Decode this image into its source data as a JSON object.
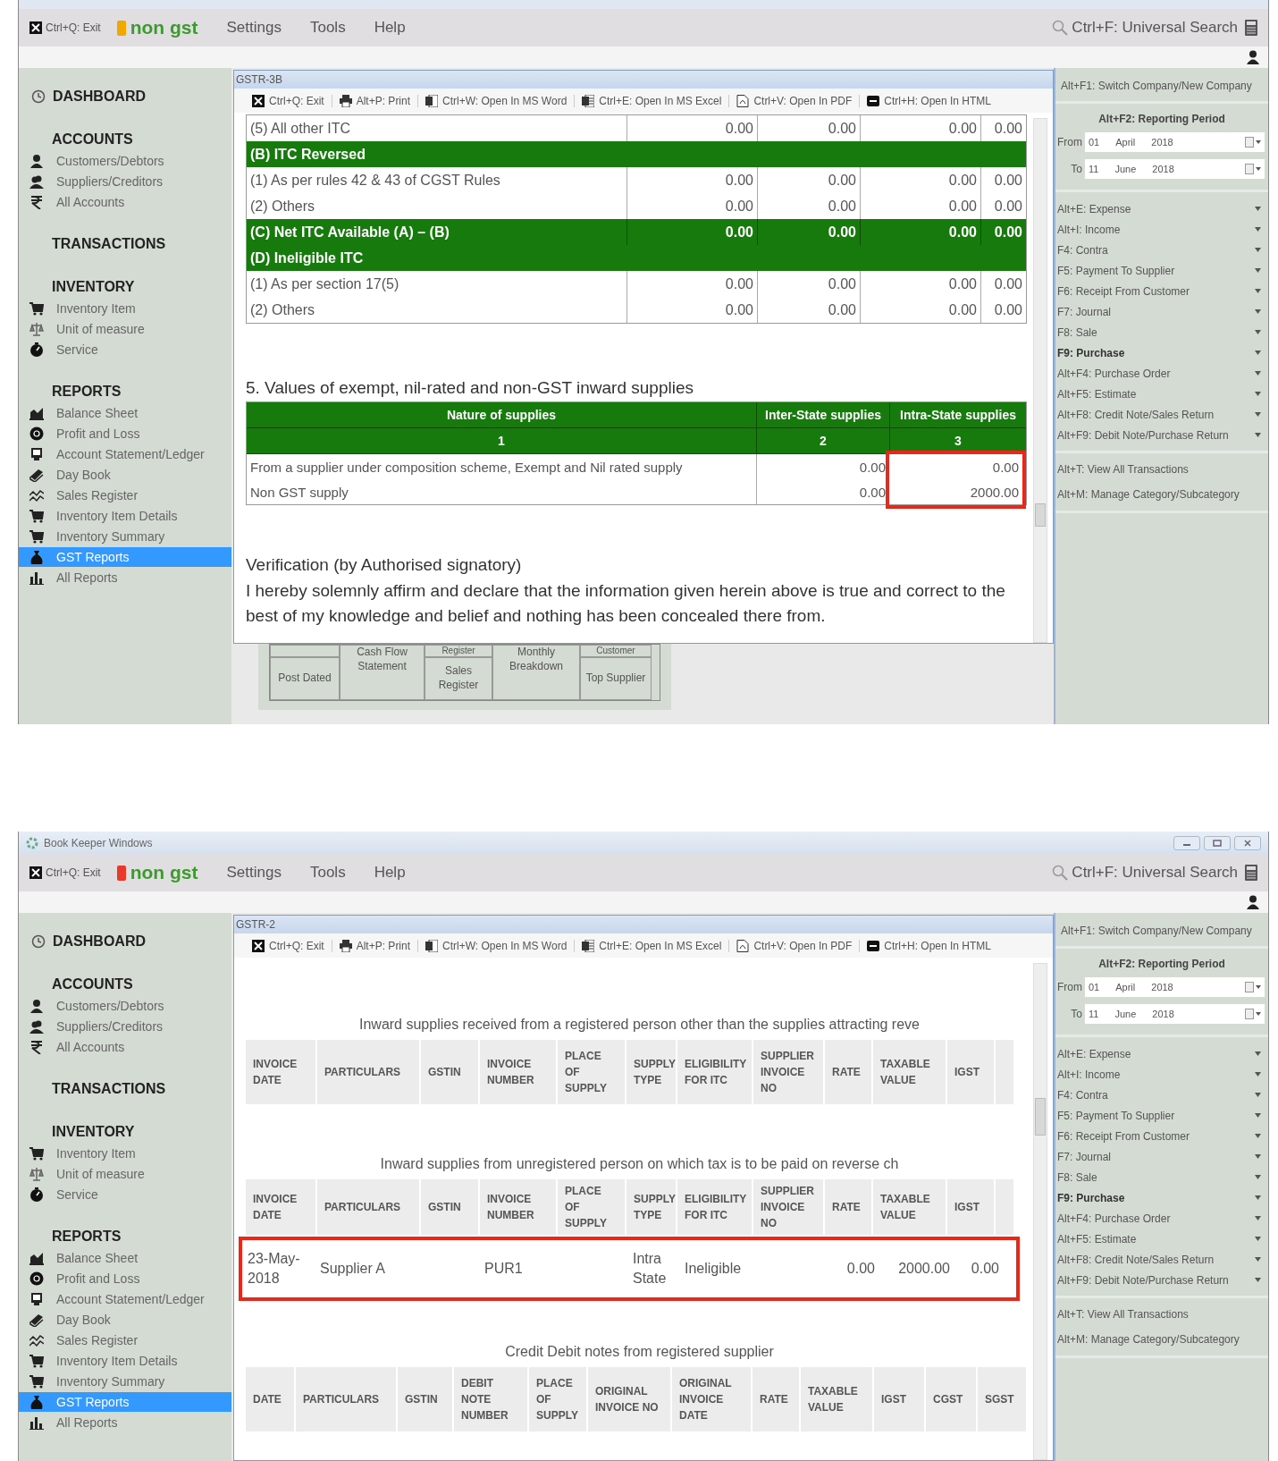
{
  "windows": [
    {
      "menubar": {
        "exit": "Ctrl+Q: Exit",
        "company": {
          "name": "non gst",
          "color": "#f0a800"
        },
        "menus": [
          "Settings",
          "Tools",
          "Help"
        ],
        "search": "Ctrl+F: Universal Search"
      },
      "sidebar": {
        "dashboard": "DASHBOARD",
        "sections": [
          {
            "title": "ACCOUNTS",
            "items": [
              {
                "label": "Customers/Debtors",
                "selected": false
              },
              {
                "label": "Suppliers/Creditors",
                "selected": false
              },
              {
                "label": "All Accounts",
                "selected": false
              }
            ]
          },
          {
            "title": "TRANSACTIONS"
          },
          {
            "title": "INVENTORY",
            "items": [
              {
                "label": "Inventory Item",
                "selected": false
              },
              {
                "label": "Unit of measure",
                "selected": false
              },
              {
                "label": "Service",
                "selected": false
              }
            ]
          },
          {
            "title": "REPORTS",
            "items": [
              {
                "label": "Balance Sheet",
                "selected": false
              },
              {
                "label": "Profit and Loss",
                "selected": false
              },
              {
                "label": "Account Statement/Ledger",
                "selected": false
              },
              {
                "label": "Day Book",
                "selected": false
              },
              {
                "label": "Sales Register",
                "selected": false
              },
              {
                "label": "Inventory Item Details",
                "selected": false
              },
              {
                "label": "Inventory Summary",
                "selected": false
              },
              {
                "label": "GST Reports",
                "selected": true
              },
              {
                "label": "All Reports",
                "selected": false
              }
            ]
          }
        ]
      },
      "dialog": {
        "kind": "gstr3b",
        "title": "GSTR-3B",
        "toolbar": [
          "Ctrl+Q: Exit",
          "Alt+P: Print",
          "Ctrl+W: Open In MS Word",
          "Ctrl+E: Open In MS Excel",
          "Ctrl+V: Open In PDF",
          "Ctrl+H: Open In HTML"
        ],
        "itc_rows": [
          {
            "kind": "row",
            "cells": [
              "(5) All other ITC",
              "0.00",
              "0.00",
              "0.00",
              "0.00"
            ]
          },
          {
            "kind": "group",
            "cells": [
              "(B) ITC Reversed"
            ]
          },
          {
            "kind": "row",
            "cells": [
              "(1) As per rules 42 & 43 of CGST Rules",
              "0.00",
              "0.00",
              "0.00",
              "0.00"
            ]
          },
          {
            "kind": "row",
            "cells": [
              "(2) Others",
              "0.00",
              "0.00",
              "0.00",
              "0.00"
            ]
          },
          {
            "kind": "total",
            "cells": [
              "(C) Net ITC Available (A) – (B)",
              "0.00",
              "0.00",
              "0.00",
              "0.00"
            ]
          },
          {
            "kind": "group",
            "cells": [
              "(D) Ineligible ITC"
            ]
          },
          {
            "kind": "row",
            "cells": [
              "(1) As per section 17(5)",
              "0.00",
              "0.00",
              "0.00",
              "0.00"
            ]
          },
          {
            "kind": "row",
            "cells": [
              "(2) Others",
              "0.00",
              "0.00",
              "0.00",
              "0.00"
            ]
          }
        ],
        "supply_heading": "5. Values of exempt, nil-rated and non-GST inward supplies",
        "supply_columns": [
          {
            "label": "Nature of supplies",
            "number": "1",
            "highlighted": false
          },
          {
            "label": "Inter-State supplies",
            "number": "2",
            "highlighted": false
          },
          {
            "label": "Intra-State supplies",
            "number": "3",
            "highlighted": true
          }
        ],
        "supply_rows": [
          [
            "From a supplier under composition scheme, Exempt and Nil rated supply",
            "0.00",
            "0.00"
          ],
          [
            "Non GST supply",
            "0.00",
            "2000.00"
          ]
        ],
        "verification_title": "Verification (by Authorised signatory)",
        "verification_text": "I hereby solemnly affirm and declare that the information given herein above is true and correct to the best of my knowledge and belief and nothing has been concealed there from."
      },
      "tiles": [
        {
          "label": "Post Dated"
        },
        {
          "label": "Cash Flow Statement"
        },
        {
          "top": "Register",
          "label": "Sales Register"
        },
        {
          "label": "Monthly Breakdown"
        },
        {
          "top": "Customer",
          "label": "Top Supplier"
        }
      ],
      "right_panel": {
        "switch_company": "Alt+F1: Switch Company/New Company",
        "period_title": "Alt+F2: Reporting Period",
        "dates": [
          {
            "label": "From",
            "day": "01",
            "month": "April",
            "year": "2018"
          },
          {
            "label": "To",
            "day": "11",
            "month": "June",
            "year": "2018"
          }
        ],
        "menu": [
          {
            "label": "Alt+E: Expense",
            "selected": false
          },
          {
            "label": "Alt+I: Income",
            "selected": false
          },
          {
            "label": "F4: Contra",
            "selected": false
          },
          {
            "label": "F5: Payment To Supplier",
            "selected": false
          },
          {
            "label": "F6: Receipt From Customer",
            "selected": false
          },
          {
            "label": "F7: Journal",
            "selected": false
          },
          {
            "label": "F8: Sale",
            "selected": false
          },
          {
            "label": "F9: Purchase",
            "selected": true
          },
          {
            "label": "Alt+F4: Purchase Order",
            "selected": false
          },
          {
            "label": "Alt+F5: Estimate",
            "selected": false
          },
          {
            "label": "Alt+F8: Credit Note/Sales Return",
            "selected": false
          },
          {
            "label": "Alt+F9: Debit Note/Purchase Return",
            "selected": false
          }
        ],
        "links": [
          "Alt+T: View All Transactions",
          "Alt+M: Manage Category/Subcategory"
        ]
      }
    },
    {
      "title": "Book Keeper Windows",
      "menubar": {
        "exit": "Ctrl+Q: Exit",
        "company": {
          "name": "non gst",
          "color": "#e83a2a"
        },
        "menus": [
          "Settings",
          "Tools",
          "Help"
        ],
        "search": "Ctrl+F: Universal Search"
      },
      "sidebar": {
        "dashboard": "DASHBOARD",
        "sections": [
          {
            "title": "ACCOUNTS",
            "items": [
              {
                "label": "Customers/Debtors",
                "selected": false
              },
              {
                "label": "Suppliers/Creditors",
                "selected": false
              },
              {
                "label": "All Accounts",
                "selected": false
              }
            ]
          },
          {
            "title": "TRANSACTIONS"
          },
          {
            "title": "INVENTORY",
            "items": [
              {
                "label": "Inventory Item",
                "selected": false
              },
              {
                "label": "Unit of measure",
                "selected": false
              },
              {
                "label": "Service",
                "selected": false
              }
            ]
          },
          {
            "title": "REPORTS",
            "items": [
              {
                "label": "Balance Sheet",
                "selected": false
              },
              {
                "label": "Profit and Loss",
                "selected": false
              },
              {
                "label": "Account Statement/Ledger",
                "selected": false
              },
              {
                "label": "Day Book",
                "selected": false
              },
              {
                "label": "Sales Register",
                "selected": false
              },
              {
                "label": "Inventory Item Details",
                "selected": false
              },
              {
                "label": "Inventory Summary",
                "selected": false
              },
              {
                "label": "GST Reports",
                "selected": true
              },
              {
                "label": "All Reports",
                "selected": false
              }
            ]
          }
        ]
      },
      "dialog": {
        "kind": "gstr2",
        "title": "GSTR-2",
        "toolbar": [
          "Ctrl+Q: Exit",
          "Alt+P: Print",
          "Ctrl+W: Open In MS Word",
          "Ctrl+E: Open In MS Excel",
          "Ctrl+V: Open In PDF",
          "Ctrl+H: Open In HTML"
        ],
        "sections": [
          {
            "title": "Inward supplies received from a registered person other than the supplies attracting reve",
            "columns": [
              "INVOICE DATE",
              "PARTICULARS",
              "GSTIN",
              "INVOICE NUMBER",
              "PLACE OF SUPPLY",
              "SUPPLY TYPE",
              "ELIGIBILITY FOR ITC",
              "SUPPLIER INVOICE NO",
              "RATE",
              "TAXABLE VALUE",
              "IGST",
              null
            ]
          },
          {
            "title": "Inward supplies from unregistered person on which tax is to be paid on reverse ch",
            "columns": [
              "INVOICE DATE",
              "PARTICULARS",
              "GSTIN",
              "INVOICE NUMBER",
              "PLACE OF SUPPLY",
              "SUPPLY TYPE",
              "ELIGIBILITY FOR ITC",
              "SUPPLIER INVOICE NO",
              "RATE",
              "TAXABLE VALUE",
              "IGST",
              null
            ],
            "rows": [
              {
                "highlighted": true,
                "cells": [
                  "23-May-2018",
                  "Supplier A",
                  null,
                  "PUR1",
                  null,
                  "Intra State",
                  "Ineligible",
                  null,
                  "0.00",
                  "2000.00",
                  "0.00",
                  null
                ]
              }
            ]
          },
          {
            "title": "Credit Debit notes from registered supplier",
            "columns": [
              "DATE",
              "PARTICULARS",
              "GSTIN",
              "DEBIT NOTE NUMBER",
              "PLACE OF SUPPLY",
              "ORIGINAL INVOICE NO",
              "ORIGINAL INVOICE DATE",
              "RATE",
              "TAXABLE VALUE",
              "IGST",
              "CGST",
              "SGST"
            ]
          }
        ]
      },
      "right_panel": {
        "switch_company": "Alt+F1: Switch Company/New Company",
        "period_title": "Alt+F2: Reporting Period",
        "dates": [
          {
            "label": "From",
            "day": "01",
            "month": "April",
            "year": "2018"
          },
          {
            "label": "To",
            "day": "11",
            "month": "June",
            "year": "2018"
          }
        ],
        "menu": [
          {
            "label": "Alt+E: Expense",
            "selected": false
          },
          {
            "label": "Alt+I: Income",
            "selected": false
          },
          {
            "label": "F4: Contra",
            "selected": false
          },
          {
            "label": "F5: Payment To Supplier",
            "selected": false
          },
          {
            "label": "F6: Receipt From Customer",
            "selected": false
          },
          {
            "label": "F7: Journal",
            "selected": false
          },
          {
            "label": "F8: Sale",
            "selected": false
          },
          {
            "label": "F9: Purchase",
            "selected": true
          },
          {
            "label": "Alt+F4: Purchase Order",
            "selected": false
          },
          {
            "label": "Alt+F5: Estimate",
            "selected": false
          },
          {
            "label": "Alt+F8: Credit Note/Sales Return",
            "selected": false
          },
          {
            "label": "Alt+F9: Debit Note/Purchase Return",
            "selected": false
          }
        ],
        "links": [
          "Alt+T: View All Transactions",
          "Alt+M: Manage Category/Subcategory"
        ]
      }
    }
  ]
}
